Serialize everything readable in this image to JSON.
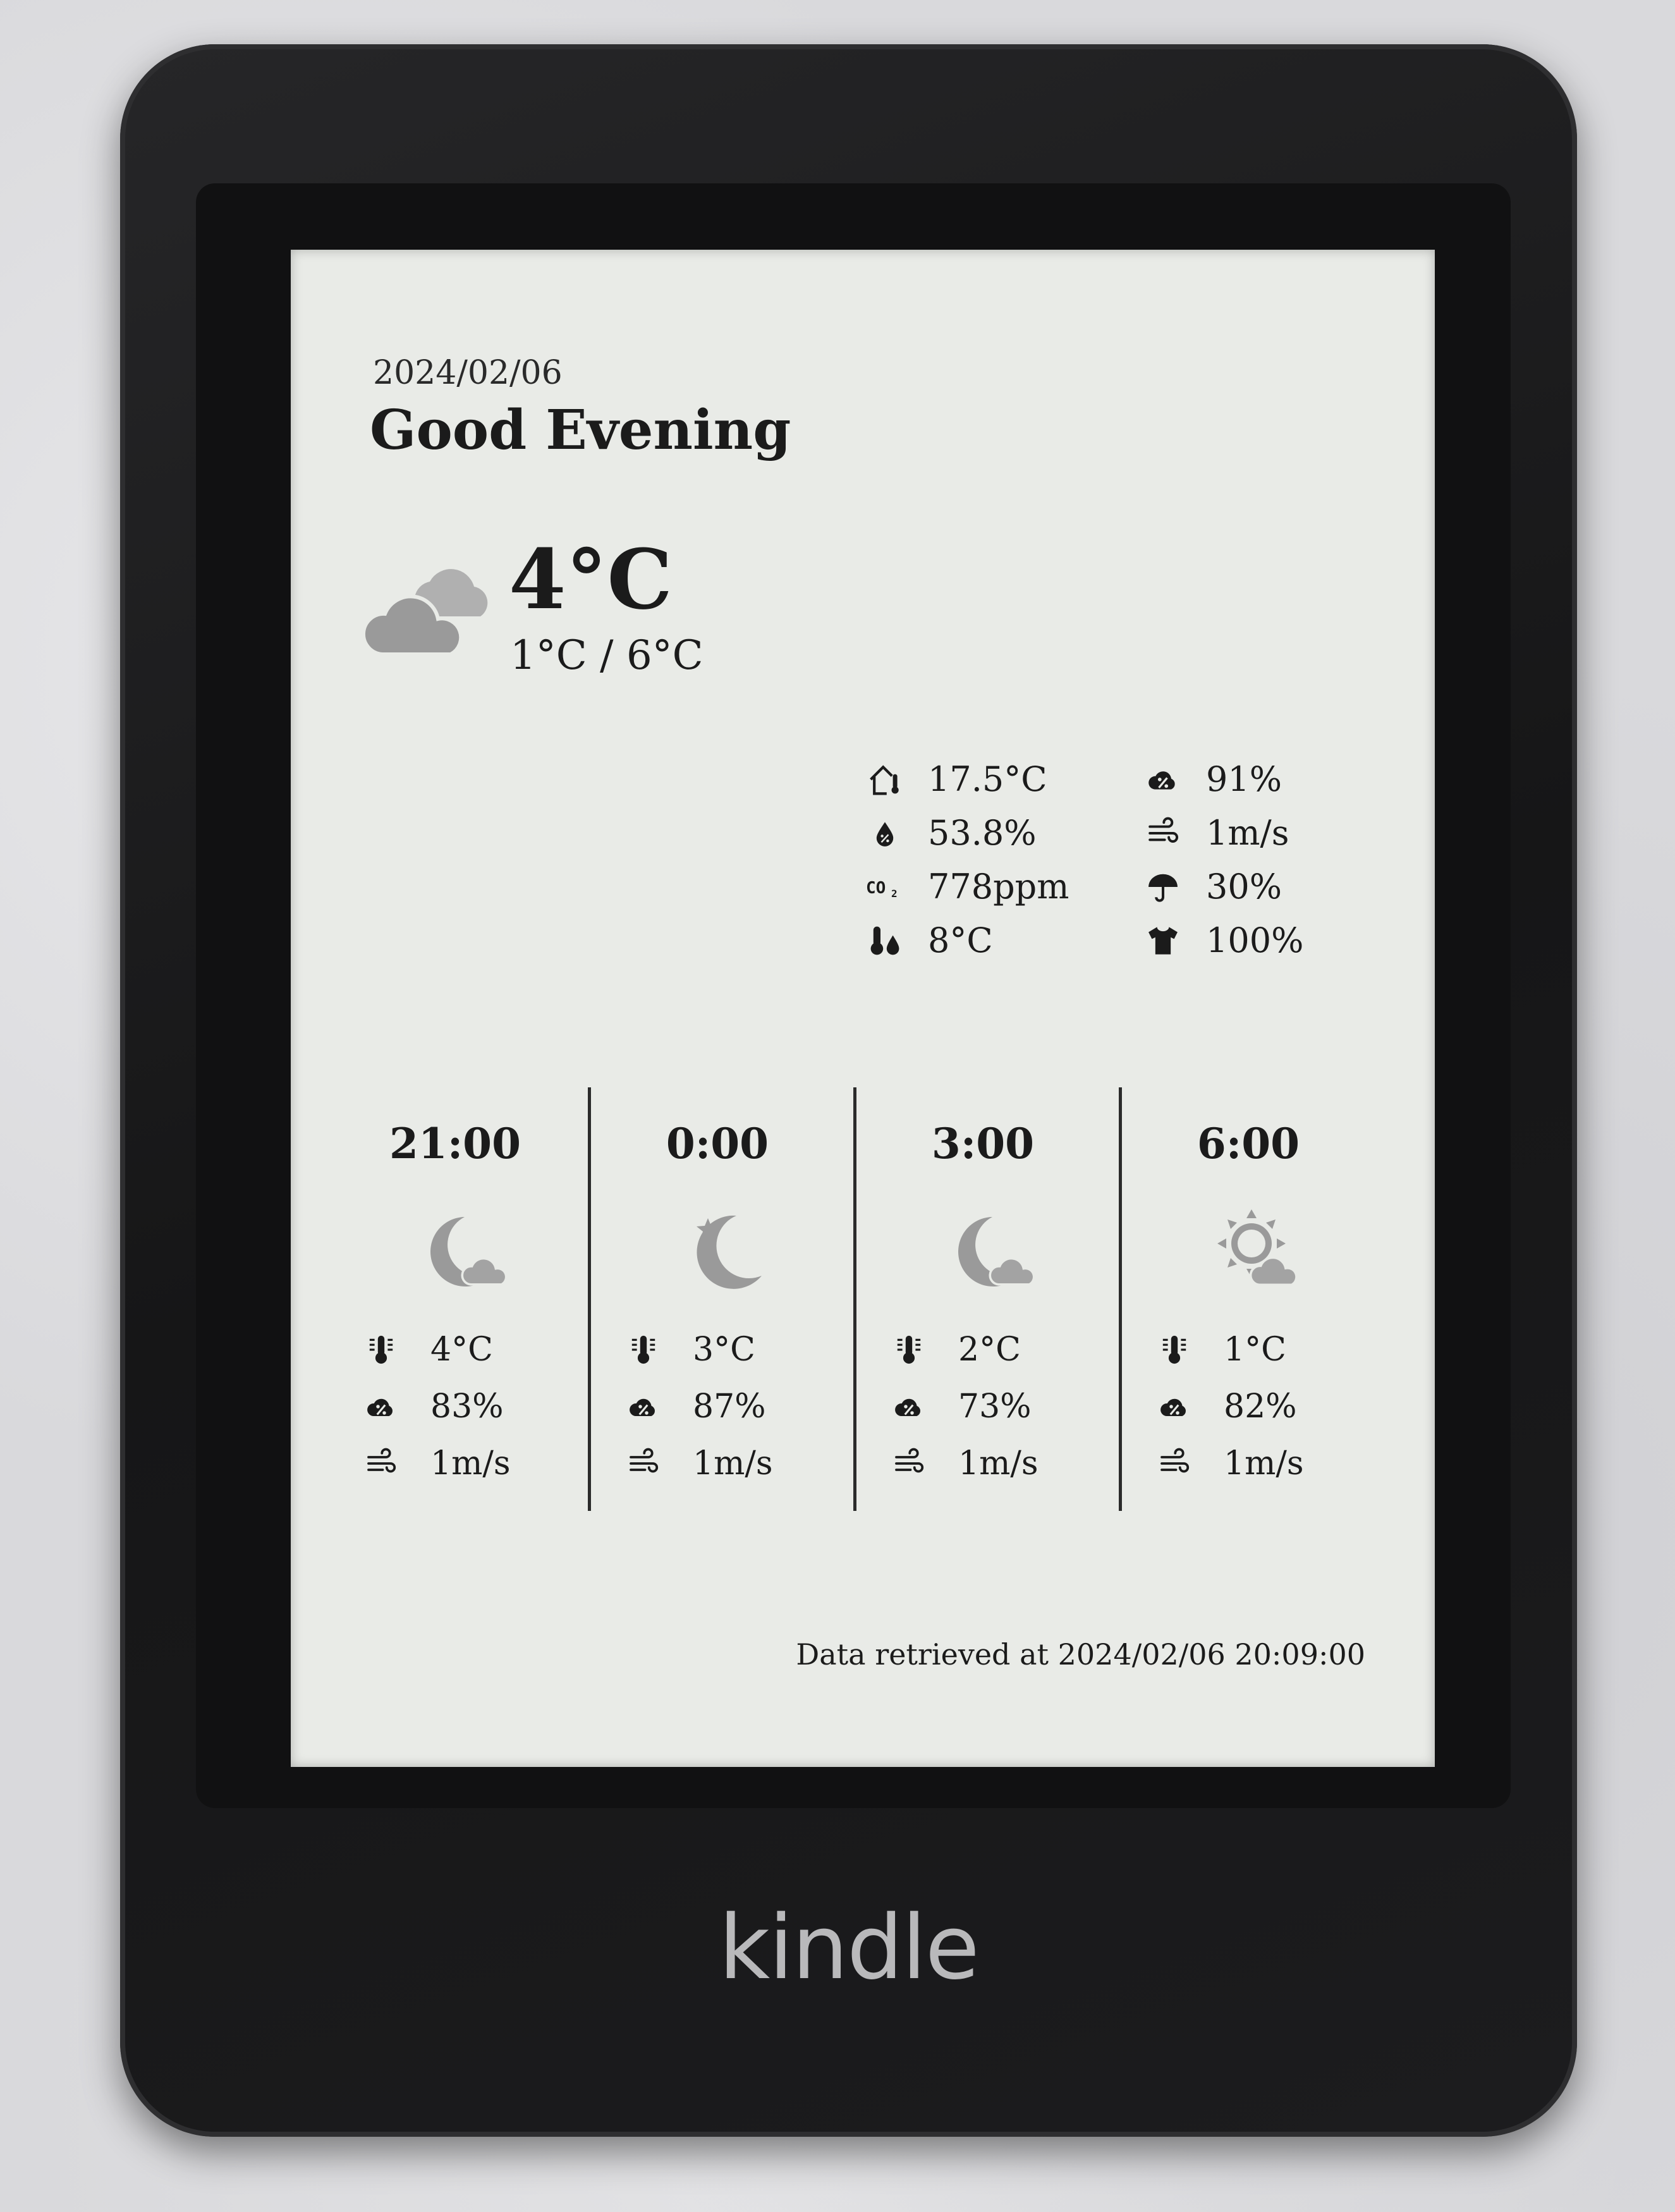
{
  "device": {
    "brand": "kindle"
  },
  "header": {
    "date": "2024/02/06",
    "greeting": "Good Evening"
  },
  "current": {
    "icon": "cloudy-icon",
    "temperature": "4°C",
    "range": "1°C / 6°C"
  },
  "details": {
    "indoor_temp": {
      "icon": "house-thermometer-icon",
      "value": "17.5°C"
    },
    "indoor_humidity": {
      "icon": "humidity-drop-icon",
      "value": "53.8%"
    },
    "co2": {
      "icon": "co2-icon",
      "value": "778ppm"
    },
    "dew_point": {
      "icon": "dew-point-icon",
      "value": "8°C"
    },
    "cloud_cover": {
      "icon": "cloud-percent-icon",
      "value": "91%"
    },
    "wind": {
      "icon": "wind-icon",
      "value": "1m/s"
    },
    "precip": {
      "icon": "umbrella-icon",
      "value": "30%"
    },
    "laundry": {
      "icon": "tshirt-icon",
      "value": "100%"
    }
  },
  "forecast": [
    {
      "time": "21:00",
      "icon": "moon-cloud-icon",
      "temp": "4°C",
      "humidity": "83%",
      "wind": "1m/s"
    },
    {
      "time": "0:00",
      "icon": "moon-star-icon",
      "temp": "3°C",
      "humidity": "87%",
      "wind": "1m/s"
    },
    {
      "time": "3:00",
      "icon": "moon-cloud-icon",
      "temp": "2°C",
      "humidity": "73%",
      "wind": "1m/s"
    },
    {
      "time": "6:00",
      "icon": "sun-cloud-icon",
      "temp": "1°C",
      "humidity": "82%",
      "wind": "1m/s"
    }
  ],
  "footer": {
    "retrieved": "Data retrieved at 2024/02/06 20:09:00"
  },
  "colors": {
    "screen": "#e9ebe7",
    "ink": "#1b1b1b",
    "icon_gray": "#9a9a9a",
    "bezel": "#161617"
  }
}
